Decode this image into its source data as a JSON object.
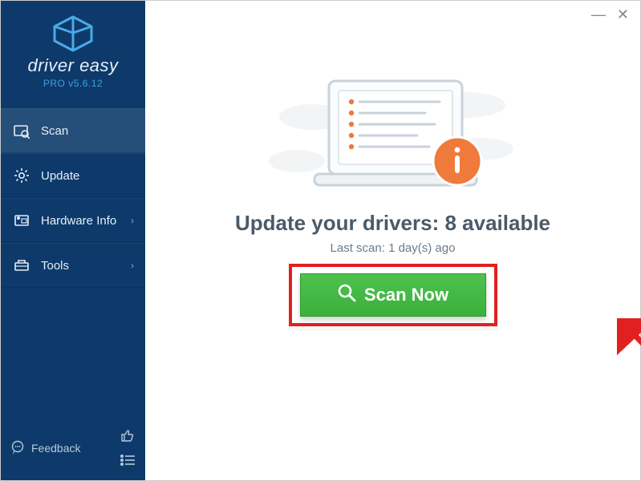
{
  "brand": "driver easy",
  "version": "PRO v5.6.12",
  "sidebar": {
    "items": [
      {
        "label": "Scan",
        "icon": "scan-icon",
        "active": true
      },
      {
        "label": "Update",
        "icon": "gear-icon"
      },
      {
        "label": "Hardware Info",
        "icon": "hardware-info-icon",
        "chevron": true
      },
      {
        "label": "Tools",
        "icon": "tools-icon",
        "chevron": true
      }
    ],
    "feedback": "Feedback"
  },
  "main": {
    "headline": "Update your drivers: 8 available",
    "subline": "Last scan: 1 day(s) ago",
    "scan_button": "Scan Now"
  }
}
